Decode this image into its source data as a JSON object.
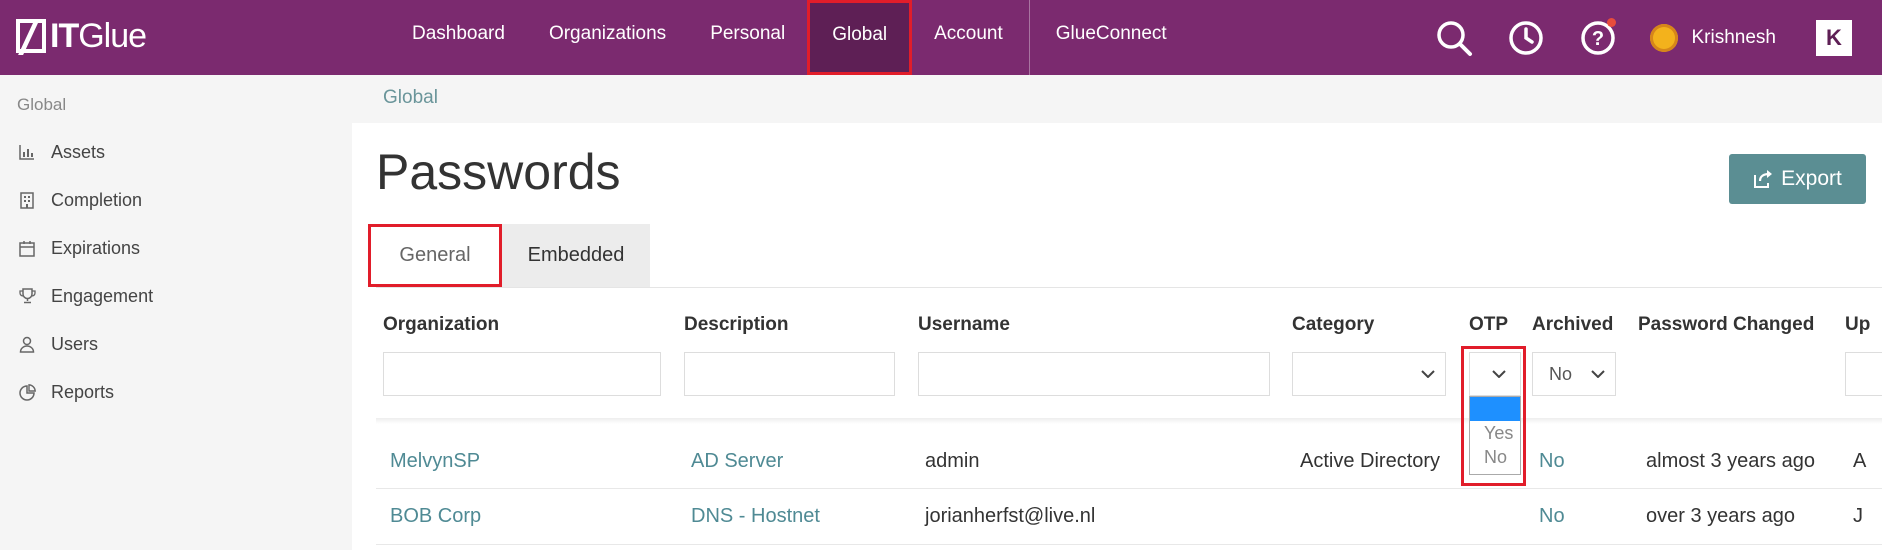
{
  "app": {
    "logo_text_bold": "IT",
    "logo_text_thin": "Glue"
  },
  "nav": {
    "items": [
      "Dashboard",
      "Organizations",
      "Personal",
      "Global",
      "Account",
      "GlueConnect"
    ]
  },
  "topbar": {
    "user_name": "Krishnesh",
    "badge_letter": "K"
  },
  "sidebar": {
    "title": "Global",
    "items": [
      {
        "label": "Assets",
        "icon": "bar-chart-icon"
      },
      {
        "label": "Completion",
        "icon": "building-icon"
      },
      {
        "label": "Expirations",
        "icon": "calendar-icon"
      },
      {
        "label": "Engagement",
        "icon": "trophy-icon"
      },
      {
        "label": "Users",
        "icon": "user-icon"
      },
      {
        "label": "Reports",
        "icon": "pie-chart-icon"
      }
    ]
  },
  "breadcrumb": "Global",
  "page": {
    "title": "Passwords",
    "export_label": "Export"
  },
  "tabs": [
    "General",
    "Embedded"
  ],
  "table": {
    "headers": [
      "Organization",
      "Description",
      "Username",
      "Category",
      "OTP",
      "Archived",
      "Password Changed",
      "Up"
    ],
    "filters": {
      "archived_value": "No"
    },
    "otp_options": [
      "",
      "Yes",
      "No"
    ],
    "rows": [
      {
        "organization": "MelvynSP",
        "description": "AD Server",
        "username": "admin",
        "category": "Active Directory",
        "archived": "No",
        "changed": "almost 3 years ago",
        "updated": "A"
      },
      {
        "organization": "BOB Corp",
        "description": "DNS - Hostnet",
        "username": "jorianherfst@live.nl",
        "category": "",
        "archived": "No",
        "changed": "over 3 years ago",
        "updated": "J"
      }
    ]
  },
  "colors": {
    "topbar": "#7b2a6f",
    "accent": "#5b8e93",
    "link": "#4f8a94",
    "highlight": "#e11d2a"
  }
}
